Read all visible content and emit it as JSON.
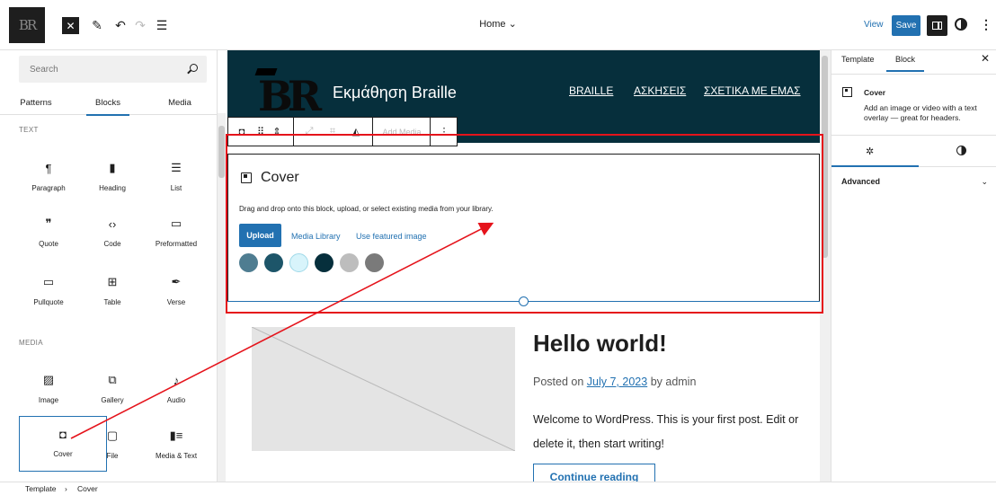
{
  "topbar": {
    "site_logo_text": "BR",
    "doc_title": "Home",
    "view_label": "View",
    "save_label": "Save"
  },
  "inserter": {
    "search_placeholder": "Search",
    "tabs": [
      "Patterns",
      "Blocks",
      "Media"
    ],
    "categories": {
      "text": "TEXT",
      "media": "MEDIA"
    },
    "text_blocks": [
      {
        "label": "Paragraph",
        "icon": "¶"
      },
      {
        "label": "Heading",
        "icon": "▮"
      },
      {
        "label": "List",
        "icon": "☰"
      },
      {
        "label": "Quote",
        "icon": "❞"
      },
      {
        "label": "Code",
        "icon": "‹›"
      },
      {
        "label": "Preformatted",
        "icon": "▭"
      },
      {
        "label": "Pullquote",
        "icon": "▭"
      },
      {
        "label": "Table",
        "icon": "⊞"
      },
      {
        "label": "Verse",
        "icon": "✒"
      }
    ],
    "media_blocks": [
      {
        "label": "Image",
        "icon": "▨"
      },
      {
        "label": "Gallery",
        "icon": "⧉"
      },
      {
        "label": "Audio",
        "icon": "♪"
      },
      {
        "label": "Cover",
        "icon": "◘"
      },
      {
        "label": "File",
        "icon": "▢"
      },
      {
        "label": "Media & Text",
        "icon": "▮≡"
      }
    ]
  },
  "canvas": {
    "site_title": "Εκμάθηση Braille",
    "nav": [
      "BRAILLE",
      "ΑΣΚΗΣΕΙΣ",
      "ΣΧΕΤΙΚΑ ΜΕ ΕΜΑΣ"
    ],
    "toolbar": {
      "add_media": "Add Media"
    },
    "cover": {
      "title": "Cover",
      "instructions": "Drag and drop onto this block, upload, or select existing media from your library.",
      "upload": "Upload",
      "media_library": "Media Library",
      "featured": "Use featured image",
      "swatches": [
        "#4f7d91",
        "#1d5569",
        "#d8f4fb",
        "#062f3c",
        "#bdbdbd",
        "#7a7a7a"
      ]
    },
    "post": {
      "title": "Hello world!",
      "posted_on": "Posted on",
      "date": "July 7, 2023",
      "by": "by admin",
      "excerpt": "Welcome to WordPress. This is your first post. Edit or delete it, then start writing!",
      "continue": "Continue reading"
    }
  },
  "sidebar": {
    "tabs": [
      "Template",
      "Block"
    ],
    "block_name": "Cover",
    "block_desc": "Add an image or video with a text overlay — great for headers.",
    "advanced": "Advanced"
  },
  "footer": {
    "crumbs": [
      "Template",
      "Cover"
    ]
  },
  "colors": {
    "accent": "#2271b1",
    "header_bg": "#062f3c",
    "annotation": "#e5131b"
  }
}
